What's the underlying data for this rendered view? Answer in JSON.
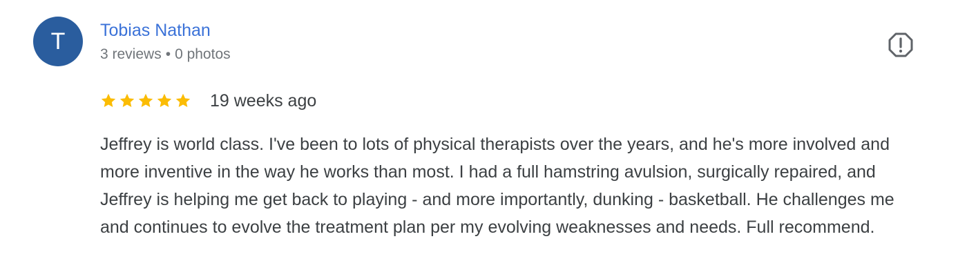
{
  "review": {
    "author": {
      "initial": "T",
      "name": "Tobias Nathan",
      "reviews": "3 reviews",
      "separator": "•",
      "photos": "0 photos"
    },
    "rating": {
      "stars": 5,
      "max": 5,
      "star_color": "#fbbc04"
    },
    "time": "19 weeks ago",
    "text": "Jeffrey is world class. I've been to lots of physical therapists over the years, and he's more involved and more inventive in the way he works than most. I had a full hamstring avulsion, surgically repaired, and Jeffrey is helping me get back to playing - and more importantly, dunking - basketball. He challenges me and continues to evolve the treatment plan per my evolving weaknesses and needs. Full recommend.",
    "report_icon": "report-icon"
  },
  "colors": {
    "avatar_bg": "#2a5d9e",
    "name": "#3b72d8",
    "meta": "#70757a",
    "body_text": "#3c4043"
  }
}
